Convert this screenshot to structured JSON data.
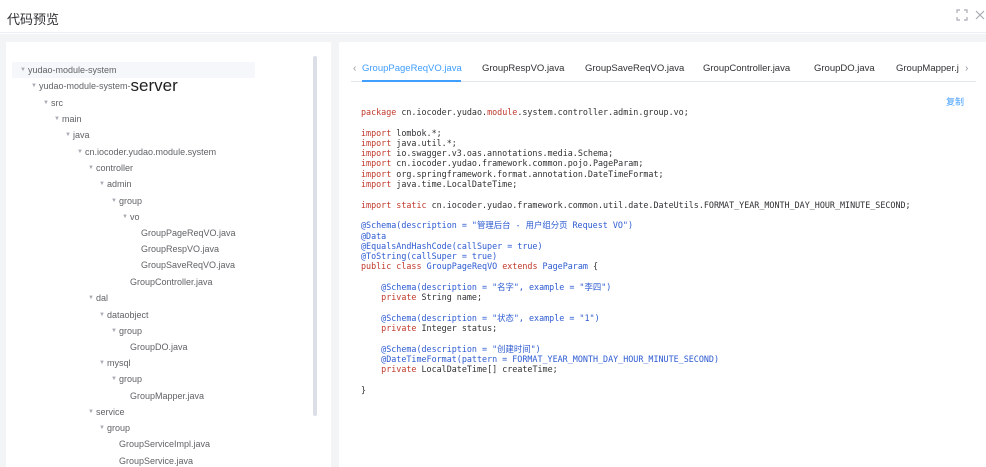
{
  "dialog": {
    "title": "代码预览",
    "fullscreen_icon": "fullscreen-icon",
    "close_icon": "close-icon"
  },
  "tree": {
    "items": [
      {
        "label": "yudao-module-system",
        "expanded": true
      },
      {
        "label": "yudao-module-system-",
        "extra": "server",
        "expanded": true
      },
      {
        "label": "src",
        "expanded": true
      },
      {
        "label": "main",
        "expanded": true
      },
      {
        "label": "java",
        "expanded": true
      },
      {
        "label": "cn.iocoder.yudao.module.system",
        "expanded": true
      },
      {
        "label": "controller",
        "expanded": true
      },
      {
        "label": "admin",
        "expanded": true
      },
      {
        "label": "group",
        "expanded": true
      },
      {
        "label": "vo",
        "expanded": true
      },
      {
        "label": "GroupPageReqVO.java"
      },
      {
        "label": "GroupRespVO.java"
      },
      {
        "label": "GroupSaveReqVO.java"
      },
      {
        "label": "GroupController.java"
      },
      {
        "label": "dal",
        "expanded": true
      },
      {
        "label": "dataobject",
        "expanded": true
      },
      {
        "label": "group",
        "expanded": true
      },
      {
        "label": "GroupDO.java"
      },
      {
        "label": "mysql",
        "expanded": true
      },
      {
        "label": "group",
        "expanded": true
      },
      {
        "label": "GroupMapper.java"
      },
      {
        "label": "service",
        "expanded": true
      },
      {
        "label": "group",
        "expanded": true
      },
      {
        "label": "GroupServiceImpl.java"
      },
      {
        "label": "GroupService.java"
      }
    ]
  },
  "tabs": {
    "items": [
      {
        "label": "GroupPageReqVO.java",
        "active": true
      },
      {
        "label": "GroupRespVO.java"
      },
      {
        "label": "GroupSaveReqVO.java"
      },
      {
        "label": "GroupController.java"
      },
      {
        "label": "GroupDO.java"
      },
      {
        "label": "GroupMapper.j"
      }
    ],
    "prev_icon": "chevron-left-icon",
    "next_icon": "chevron-right-icon"
  },
  "copy_label": "复制",
  "code": {
    "lines": [
      [
        {
          "t": "package ",
          "c": "kw"
        },
        {
          "t": "cn.iocoder.yudao.",
          "c": ""
        },
        {
          "t": "module",
          "c": "kw"
        },
        {
          "t": ".system.controller.admin.group.vo;",
          "c": ""
        }
      ],
      [],
      [
        {
          "t": "import ",
          "c": "kw"
        },
        {
          "t": "lombok.*;",
          "c": ""
        }
      ],
      [
        {
          "t": "import ",
          "c": "kw"
        },
        {
          "t": "java.util.*;",
          "c": ""
        }
      ],
      [
        {
          "t": "import ",
          "c": "kw"
        },
        {
          "t": "io.swagger.v3.oas.annotations.media.Schema;",
          "c": ""
        }
      ],
      [
        {
          "t": "import ",
          "c": "kw"
        },
        {
          "t": "cn.iocoder.yudao.framework.common.pojo.PageParam;",
          "c": ""
        }
      ],
      [
        {
          "t": "import ",
          "c": "kw"
        },
        {
          "t": "org.springframework.format.annotation.DateTimeFormat;",
          "c": ""
        }
      ],
      [
        {
          "t": "import ",
          "c": "kw"
        },
        {
          "t": "java.time.LocalDateTime;",
          "c": ""
        }
      ],
      [],
      [
        {
          "t": "import static ",
          "c": "kw"
        },
        {
          "t": "cn.iocoder.yudao.framework.common.util.date.DateUtils.FORMAT_YEAR_MONTH_DAY_HOUR_MINUTE_SECOND;",
          "c": ""
        }
      ],
      [],
      [
        {
          "t": "@Schema(description = \"管理后台 - 用户组分页 Request VO\")",
          "c": "an"
        }
      ],
      [
        {
          "t": "@Data",
          "c": "an"
        }
      ],
      [
        {
          "t": "@EqualsAndHashCode(callSuper = true)",
          "c": "an"
        }
      ],
      [
        {
          "t": "@ToString(callSuper = true)",
          "c": "an"
        }
      ],
      [
        {
          "t": "public class ",
          "c": "kw"
        },
        {
          "t": "GroupPageReqVO ",
          "c": "an"
        },
        {
          "t": "extends ",
          "c": "kw"
        },
        {
          "t": "PageParam",
          "c": "an"
        },
        {
          "t": " {",
          "c": ""
        }
      ],
      [],
      [
        {
          "t": "    @Schema(description = \"名字\", example = \"李四\")",
          "c": "an"
        }
      ],
      [
        {
          "t": "    private ",
          "c": "kw"
        },
        {
          "t": "String name;",
          "c": ""
        }
      ],
      [],
      [
        {
          "t": "    @Schema(description = \"状态\", example = \"1\")",
          "c": "an"
        }
      ],
      [
        {
          "t": "    private ",
          "c": "kw"
        },
        {
          "t": "Integer status;",
          "c": ""
        }
      ],
      [],
      [
        {
          "t": "    @Schema(description = \"创建时间\")",
          "c": "an"
        }
      ],
      [
        {
          "t": "    @DateTimeFormat(pattern = FORMAT_YEAR_MONTH_DAY_HOUR_MINUTE_SECOND)",
          "c": "an"
        }
      ],
      [
        {
          "t": "    private ",
          "c": "kw"
        },
        {
          "t": "LocalDateTime[] createTime;",
          "c": ""
        }
      ],
      [],
      [
        {
          "t": "}",
          "c": ""
        }
      ]
    ]
  },
  "colors": {
    "accent": "#409eff",
    "keyword": "#c0392b",
    "annotation": "#2d5bd1"
  }
}
